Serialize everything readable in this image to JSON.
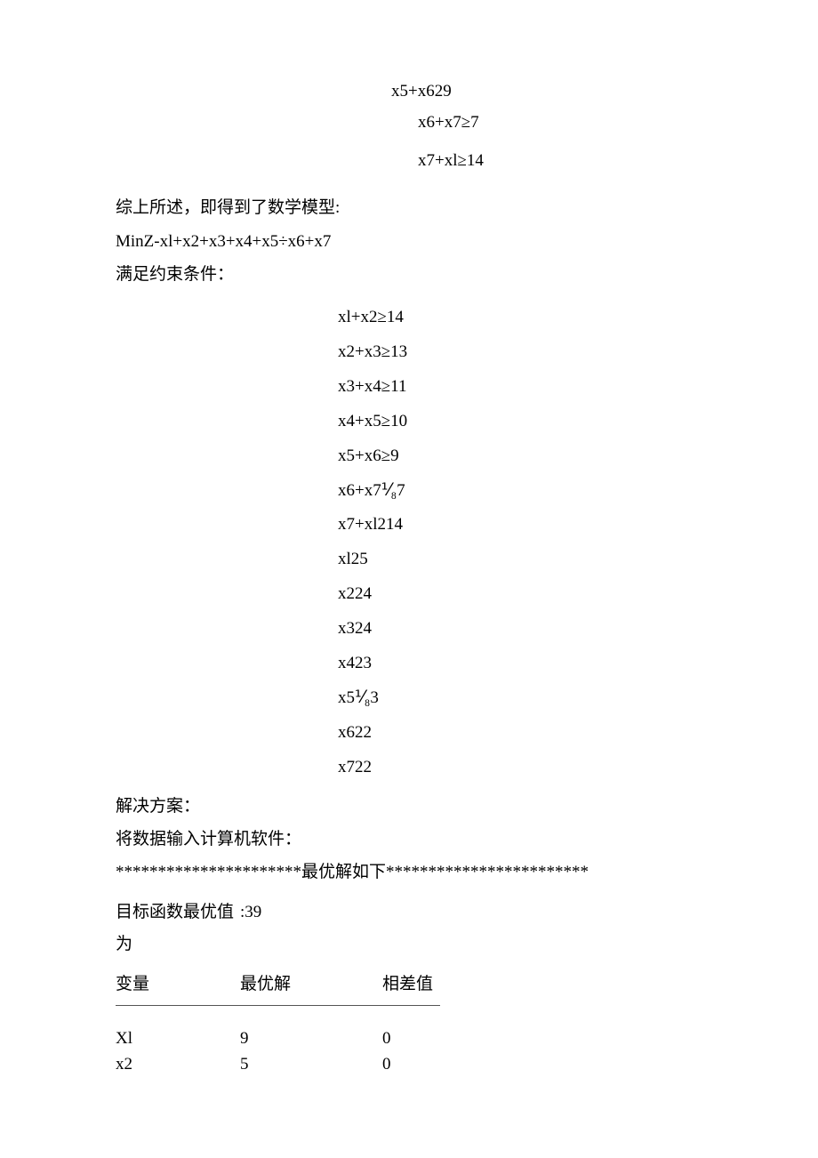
{
  "top": {
    "l1": "x5+x629",
    "l2": "x6+x7≥7",
    "l3": "x7+xl≥14"
  },
  "intro": {
    "p1": "综上所述，即得到了数学模型:",
    "obj": "MinZ-xl+x2+x3+x4+x5÷x6+x7",
    "p2": "满足约束条件："
  },
  "constraints": [
    "xl+x2≥14",
    "x2+x3≥13",
    "x3+x4≥11",
    "x4+x5≥10",
    "x5+x6≥9",
    "x6+x7⅟₈7",
    "x7+xl214",
    "xl25",
    "x224",
    "x324",
    "x423",
    "x5⅟₈3",
    "x622",
    "x722"
  ],
  "solution": {
    "head": "解决方案：",
    "input": "将数据输入计算机软件：",
    "stars": "**********************最优解如下************************",
    "opt_label": "目标函数最优值为",
    "opt_value": ":39",
    "col1": "变量",
    "col2": "最优解",
    "col3": "相差值",
    "rows": [
      {
        "v": "Xl",
        "o": "9",
        "d": "0"
      },
      {
        "v": "x2",
        "o": "5",
        "d": "0"
      }
    ]
  }
}
